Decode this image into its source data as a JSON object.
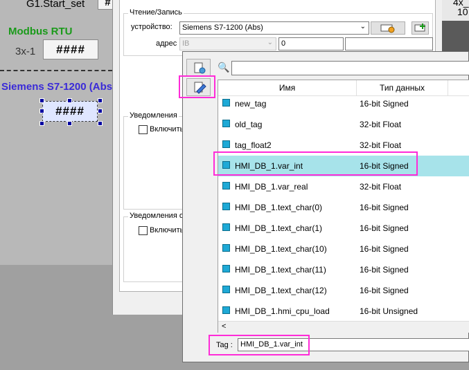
{
  "canvas": {
    "start_label": "G1.Start_set",
    "start_hash_partial": "#",
    "modbus_title": "Modbus RTU",
    "reg_label": "3x-1",
    "reg_value": "####",
    "siemens_title": "Siemens S7-1200 (Abs",
    "siemens_value": "####"
  },
  "dialog": {
    "rw_group_title": "Чтение/Запись",
    "device_label": "устройство:",
    "device_value": "Siemens S7-1200 (Abs)",
    "address_label": "адрес :",
    "address_type": "IB",
    "address_value": "0",
    "notify_group_title": "Уведомления",
    "notify_enable": "Включить",
    "notify2_group_title": "Уведомления о",
    "notify2_enable": "Включить"
  },
  "right_strip": {
    "line1": "4x_",
    "line2": "10"
  },
  "tag_browser": {
    "search_placeholder": "",
    "columns": [
      "Имя",
      "Тип данных"
    ],
    "rows": [
      {
        "name": "new_tag",
        "type": "16-bit Signed"
      },
      {
        "name": "old_tag",
        "type": "32-bit Float"
      },
      {
        "name": "tag_float2",
        "type": "32-bit Float"
      },
      {
        "name": "HMI_DB_1.var_int",
        "type": "16-bit Signed"
      },
      {
        "name": "HMI_DB_1.var_real",
        "type": "32-bit Float"
      },
      {
        "name": "HMI_DB_1.text_char(0)",
        "type": "16-bit Signed"
      },
      {
        "name": "HMI_DB_1.text_char(1)",
        "type": "16-bit Signed"
      },
      {
        "name": "HMI_DB_1.text_char(10)",
        "type": "16-bit Signed"
      },
      {
        "name": "HMI_DB_1.text_char(11)",
        "type": "16-bit Signed"
      },
      {
        "name": "HMI_DB_1.text_char(12)",
        "type": "16-bit Signed"
      },
      {
        "name": "HMI_DB_1.hmi_cpu_load",
        "type": "16-bit Unsigned"
      }
    ],
    "selected_index": 3,
    "tag_label": "Tag :",
    "tag_value": "HMI_DB_1.var_int",
    "scroll_left_glyph": "<",
    "search_glyph": "🔍"
  },
  "colors": {
    "highlight": "#ff2bd8",
    "selected_row": "#a7e3ea",
    "modbus_green": "#1a9a1a",
    "siemens_blue": "#3a2ad8"
  }
}
